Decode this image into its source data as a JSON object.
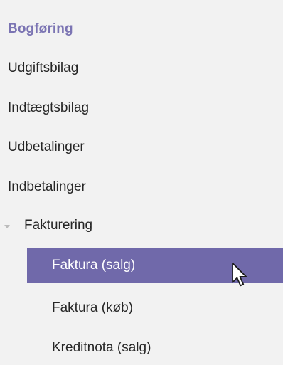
{
  "nav": {
    "section_title": "Bogføring",
    "items": [
      {
        "label": "Udgiftsbilag"
      },
      {
        "label": "Indtægtsbilag"
      },
      {
        "label": "Udbetalinger"
      },
      {
        "label": "Indbetalinger"
      },
      {
        "label": "Fakturering",
        "expanded": true
      }
    ],
    "subitems": [
      {
        "label": "Faktura (salg)",
        "selected": true
      },
      {
        "label": "Faktura (køb)"
      },
      {
        "label": "Kreditnota (salg)"
      }
    ]
  },
  "colors": {
    "section_title": "#7b74b3",
    "selected_bg": "#7069aa",
    "selected_text": "#ffffff",
    "text": "#262626",
    "background": "#f2f2f2"
  },
  "icons": {
    "expand": "triangle-down-icon",
    "cursor": "mouse-pointer-icon"
  }
}
